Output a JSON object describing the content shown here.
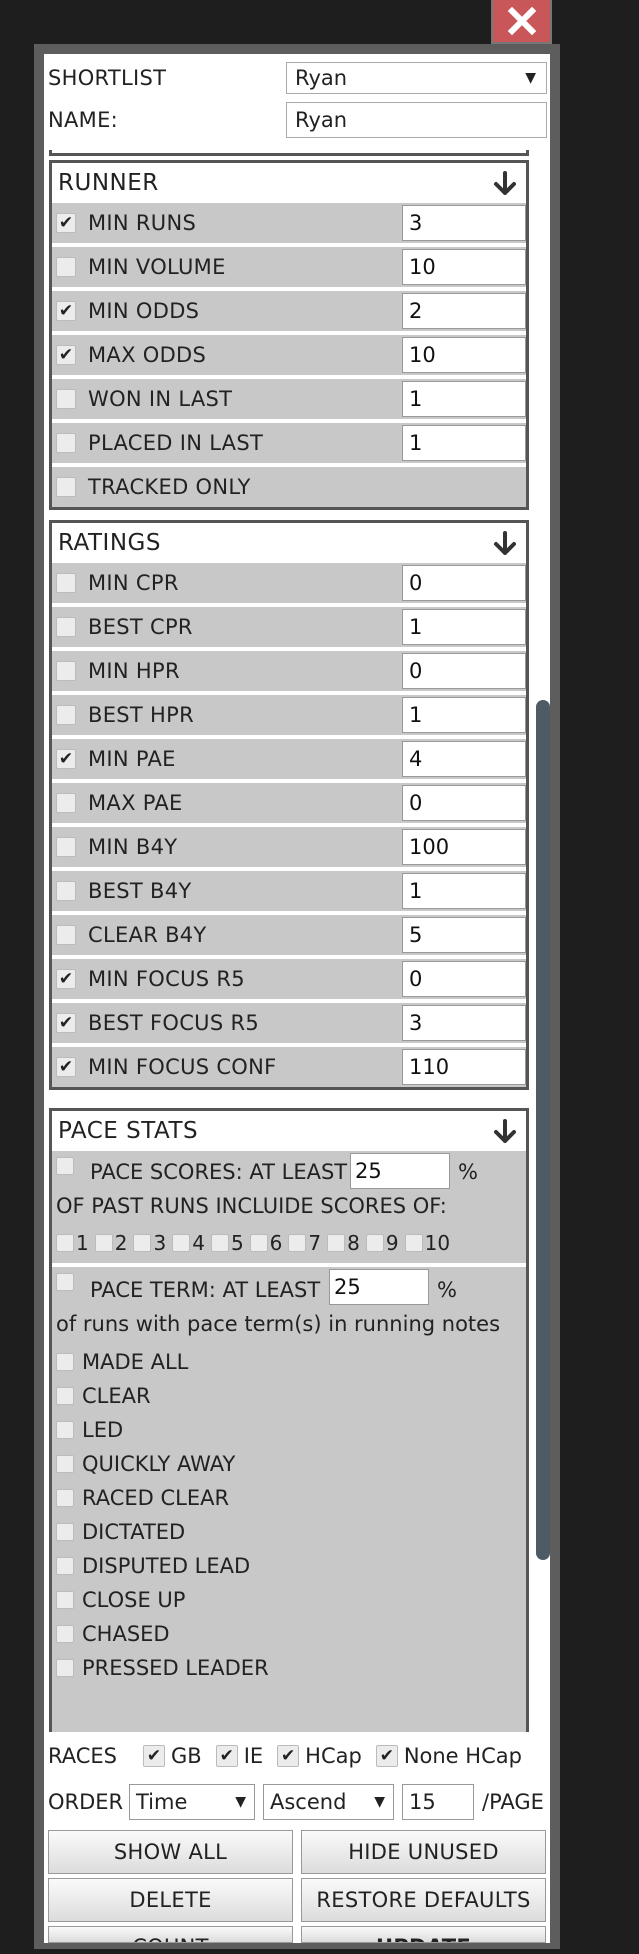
{
  "header": {
    "shortlist_label": "SHORTLIST",
    "shortlist_value": "Ryan",
    "name_label": "NAME:",
    "name_value": "Ryan"
  },
  "runner": {
    "title": "RUNNER",
    "rows": [
      {
        "label": "MIN RUNS",
        "checked": true,
        "value": "3"
      },
      {
        "label": "MIN VOLUME",
        "checked": false,
        "value": "10"
      },
      {
        "label": "MIN ODDS",
        "checked": true,
        "value": "2"
      },
      {
        "label": "MAX ODDS",
        "checked": true,
        "value": "10"
      },
      {
        "label": "WON IN LAST",
        "checked": false,
        "value": "1"
      },
      {
        "label": "PLACED IN LAST",
        "checked": false,
        "value": "1"
      },
      {
        "label": "TRACKED ONLY",
        "checked": false,
        "value": null
      }
    ]
  },
  "ratings": {
    "title": "RATINGS",
    "rows": [
      {
        "label": "MIN CPR",
        "checked": false,
        "value": "0"
      },
      {
        "label": "BEST CPR",
        "checked": false,
        "value": "1"
      },
      {
        "label": "MIN HPR",
        "checked": false,
        "value": "0"
      },
      {
        "label": "BEST HPR",
        "checked": false,
        "value": "1"
      },
      {
        "label": "MIN PAE",
        "checked": true,
        "value": "4"
      },
      {
        "label": "MAX PAE",
        "checked": false,
        "value": "0"
      },
      {
        "label": "MIN B4Y",
        "checked": false,
        "value": "100"
      },
      {
        "label": "BEST B4Y",
        "checked": false,
        "value": "1"
      },
      {
        "label": "CLEAR B4Y",
        "checked": false,
        "value": "5"
      },
      {
        "label": "MIN FOCUS R5",
        "checked": true,
        "value": "0"
      },
      {
        "label": "BEST FOCUS R5",
        "checked": true,
        "value": "3"
      },
      {
        "label": "MIN FOCUS CONF",
        "checked": true,
        "value": "110"
      }
    ]
  },
  "pace": {
    "title": "PACE STATS",
    "scores_label": "PACE SCORES: AT LEAST",
    "scores_value": "25",
    "percent": "%",
    "past_runs_label": "OF PAST RUNS INCLUIDE SCORES OF:",
    "score_options": [
      "1",
      "2",
      "3",
      "4",
      "5",
      "6",
      "7",
      "8",
      "9",
      "10"
    ],
    "term_label": "PACE TERM: AT LEAST",
    "term_value": "25",
    "term_desc": "of runs with pace term(s) in running notes",
    "terms": [
      "MADE ALL",
      "CLEAR",
      "LED",
      "QUICKLY AWAY",
      "RACED CLEAR",
      "DICTATED",
      "DISPUTED LEAD",
      "CLOSE UP",
      "CHASED",
      "PRESSED LEADER"
    ]
  },
  "races": {
    "label": "RACES",
    "options": [
      {
        "label": "GB",
        "checked": true
      },
      {
        "label": "IE",
        "checked": true
      },
      {
        "label": "HCap",
        "checked": true
      },
      {
        "label": "None HCap",
        "checked": true
      }
    ]
  },
  "order": {
    "label": "ORDER",
    "sort_field": "Time",
    "sort_dir": "Ascend",
    "per_page": "15",
    "per_page_label": "/PAGE"
  },
  "buttons": {
    "show_all": "SHOW ALL",
    "hide_unused": "HIDE UNUSED",
    "delete": "DELETE",
    "restore_defaults": "RESTORE DEFAULTS",
    "count": "COUNT",
    "update": "UPDATE"
  },
  "icons": {
    "close": "close-icon",
    "collapse": "arrow-down-icon"
  },
  "colors": {
    "close_bg": "#c9575a",
    "scroll_thumb": "#4e5a64",
    "row_bg": "#c8c8c8"
  }
}
